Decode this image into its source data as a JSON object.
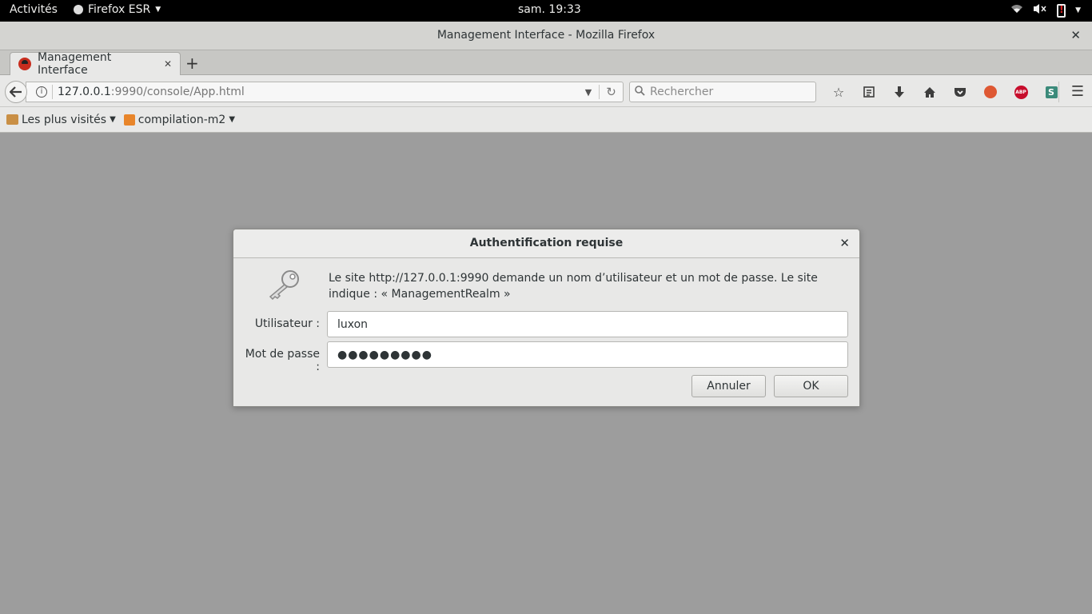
{
  "topbar": {
    "activities": "Activités",
    "app_name": "Firefox ESR",
    "clock": "sam. 19:33"
  },
  "window": {
    "title": "Management Interface - Mozilla Firefox"
  },
  "tab": {
    "label": "Management Interface"
  },
  "navbar": {
    "url_host": "127.0.0.1",
    "url_rest": ":9990/console/App.html",
    "search_placeholder": "Rechercher",
    "abp_label": "ABP",
    "s_label": "S"
  },
  "bookmarks": [
    {
      "label": "Les plus visités"
    },
    {
      "label": "compilation-m2"
    }
  ],
  "dialog": {
    "title": "Authentification requise",
    "message": "Le site http://127.0.0.1:9990 demande un nom d’utilisateur et un mot de passe. Le site indique : « ManagementRealm »",
    "username_label": "Utilisateur :",
    "username_value": "luxon",
    "password_label": "Mot de passe :",
    "password_value": "●●●●●●●●●",
    "cancel_label": "Annuler",
    "ok_label": "OK"
  }
}
